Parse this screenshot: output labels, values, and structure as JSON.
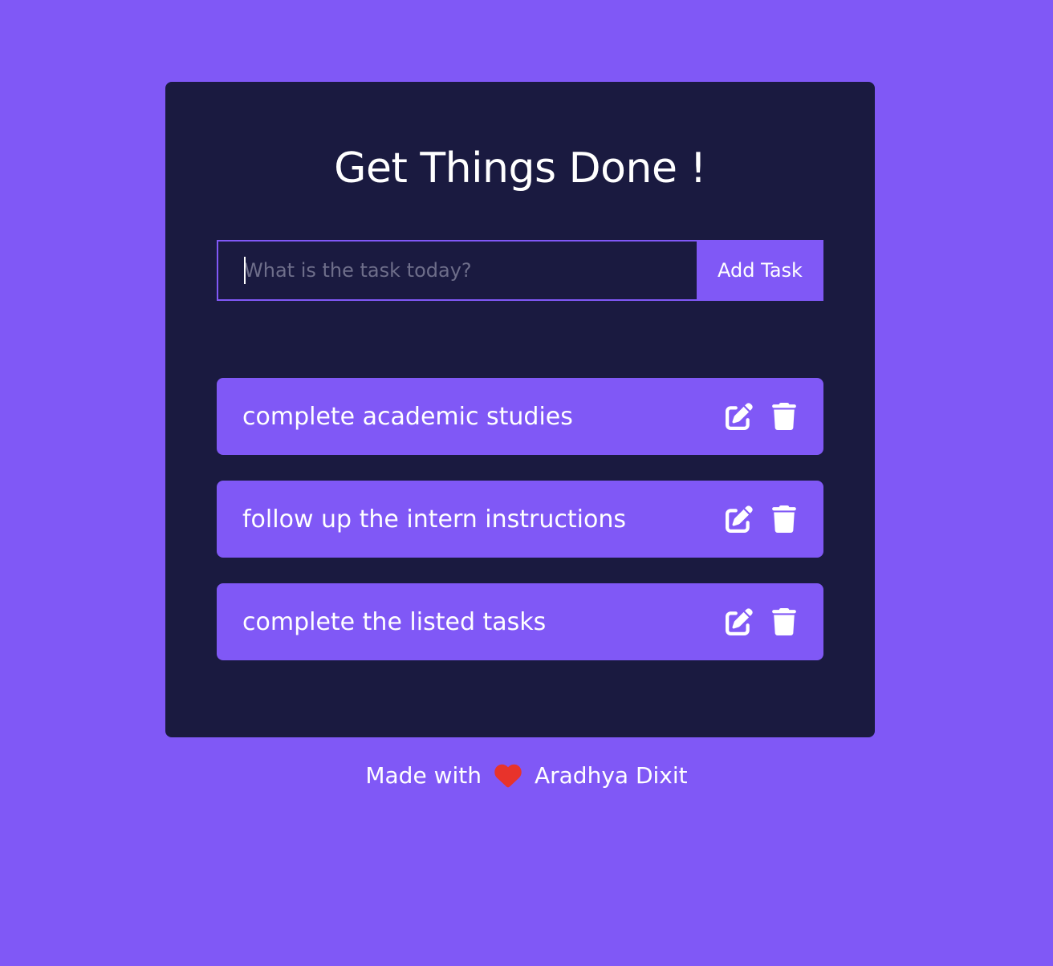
{
  "app": {
    "title": "Get Things Done !"
  },
  "form": {
    "placeholder": "What is the task today?",
    "value": "",
    "add_label": "Add Task"
  },
  "todos": [
    {
      "text": "complete academic studies"
    },
    {
      "text": "follow up the intern instructions"
    },
    {
      "text": "complete the listed tasks"
    }
  ],
  "icons": {
    "edit": "edit-icon",
    "delete": "trash-icon",
    "heart": "heart-icon"
  },
  "footer": {
    "made_with": "Made with",
    "author": "Aradhya Dixit"
  },
  "colors": {
    "background": "#8058f6",
    "card": "#1a1a40",
    "accent": "#8058f6",
    "heart": "#e8332b"
  }
}
